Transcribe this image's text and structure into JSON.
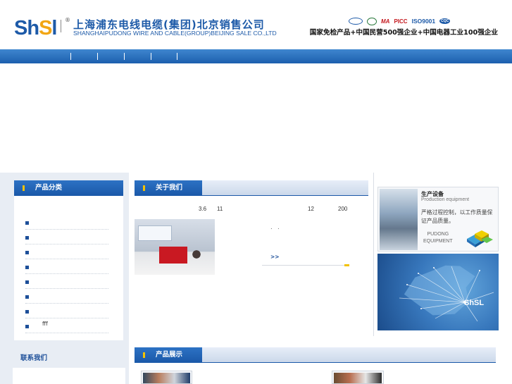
{
  "header": {
    "logo": {
      "prefix": "Sh",
      "highlight": "S",
      "suffix": "l"
    },
    "registered": "®",
    "company_cn": "上海浦东电线电缆(集团)北京销售公司",
    "company_en": "SHANGHAIPUDONG WIRE AND CABLE(GROUP)BEIJING SALE CO.,LTD",
    "certifications": [
      "MA",
      "PICC",
      "ISO9001",
      "CQC"
    ],
    "slogan": "国家免检产品+中国民营500强企业+中国电器工业100强企业"
  },
  "navigation": {
    "separators": [
      "|",
      "|",
      "|",
      "|",
      "|"
    ]
  },
  "sidebar": {
    "title": "产品分类",
    "items": [
      "",
      "",
      "",
      "",
      "",
      "",
      "",
      "fff"
    ]
  },
  "about": {
    "title": "关于我们",
    "numbers": [
      "3.6",
      "11",
      "12",
      "200"
    ],
    "punctuation": "·",
    "more": ">>"
  },
  "equipment": {
    "title": "生产设备",
    "subtitle": "Production equipment",
    "description": "严格过程控制，以工作质量保证产品质量。",
    "brand_line_1": "PUDONG",
    "brand_line_2": "EQUIPMENT"
  },
  "map": {
    "logo": "ShSL"
  },
  "contact": {
    "title": "联系我们"
  },
  "products": {
    "title": "产品展示"
  },
  "colors": {
    "primary": "#1D5AA8",
    "accent": "#F2A614",
    "highlight": "#F2C200"
  }
}
